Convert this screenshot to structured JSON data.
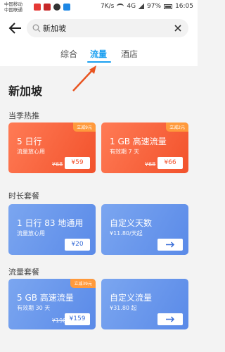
{
  "status_bar": {
    "carrier1": "中国移动",
    "carrier2": "中国联通",
    "net_speed": "7K/s",
    "network": "4G",
    "battery": "97%",
    "time": "16:05"
  },
  "search": {
    "query": "新加坡"
  },
  "tabs": [
    {
      "label": "综合"
    },
    {
      "label": "流量"
    },
    {
      "label": "酒店"
    }
  ],
  "page": {
    "city": "新加坡"
  },
  "sections": [
    {
      "title": "当季热推",
      "cards": [
        {
          "title": "5 日行",
          "subtitle": "流量放心用",
          "badge": "立减9元",
          "original_price": "¥68",
          "price": "¥59",
          "style": "orange"
        },
        {
          "title": "1 GB 高速流量",
          "subtitle": "有效期 7 天",
          "badge": "立减2元",
          "original_price": "¥68",
          "price": "¥66",
          "style": "orange"
        }
      ]
    },
    {
      "title": "时长套餐",
      "cards": [
        {
          "title": "1 日行  83 地通用",
          "subtitle": "流量放心用",
          "price": "¥20",
          "style": "blue"
        },
        {
          "title": "自定义天数",
          "subtitle": "¥11.80/天起",
          "action": "arrow-right-icon",
          "style": "blue"
        }
      ]
    },
    {
      "title": "流量套餐",
      "cards": [
        {
          "title": "5 GB 高速流量",
          "subtitle": "有效期 30 天",
          "badge": "立减39元",
          "original_price": "¥198",
          "price": "¥159",
          "style": "blue"
        },
        {
          "title": "自定义流量",
          "subtitle": "¥31.80 起",
          "action": "arrow-right-icon",
          "style": "blue"
        }
      ]
    }
  ],
  "colors": {
    "accent": "#1a9ff0",
    "orange_card": "#f2522c",
    "blue_card": "#5a8ae8",
    "annotation_arrow": "#e8531f"
  }
}
